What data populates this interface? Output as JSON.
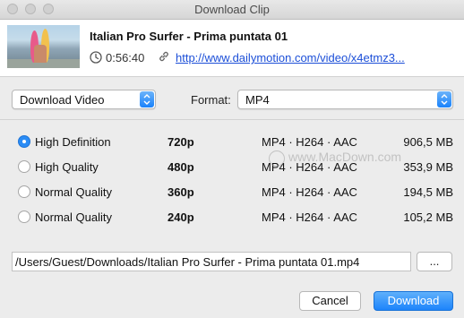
{
  "window": {
    "title": "Download Clip"
  },
  "clip": {
    "title": "Italian Pro Surfer - Prima puntata 01",
    "duration": "0:56:40",
    "url": "http://www.dailymotion.com/video/x4etmz3..."
  },
  "options": {
    "download_type": "Download Video",
    "format_label": "Format:",
    "format_value": "MP4"
  },
  "qualities": [
    {
      "label": "High Definition",
      "resolution": "720p",
      "codec": "MP4 · H264 · AAC",
      "size": "906,5 MB",
      "selected": true
    },
    {
      "label": "High Quality",
      "resolution": "480p",
      "codec": "MP4 · H264 · AAC",
      "size": "353,9 MB",
      "selected": false
    },
    {
      "label": "Normal Quality",
      "resolution": "360p",
      "codec": "MP4 · H264 · AAC",
      "size": "194,5 MB",
      "selected": false
    },
    {
      "label": "Normal Quality",
      "resolution": "240p",
      "codec": "MP4 · H264 · AAC",
      "size": "105,2 MB",
      "selected": false
    }
  ],
  "watermark": "www.MacDown.com",
  "save": {
    "path": "/Users/Guest/Downloads/Italian Pro Surfer - Prima puntata 01.mp4",
    "browse_label": "..."
  },
  "buttons": {
    "cancel": "Cancel",
    "download": "Download"
  },
  "colors": {
    "accent": "#1d84fb",
    "link": "#1c4fd8"
  }
}
